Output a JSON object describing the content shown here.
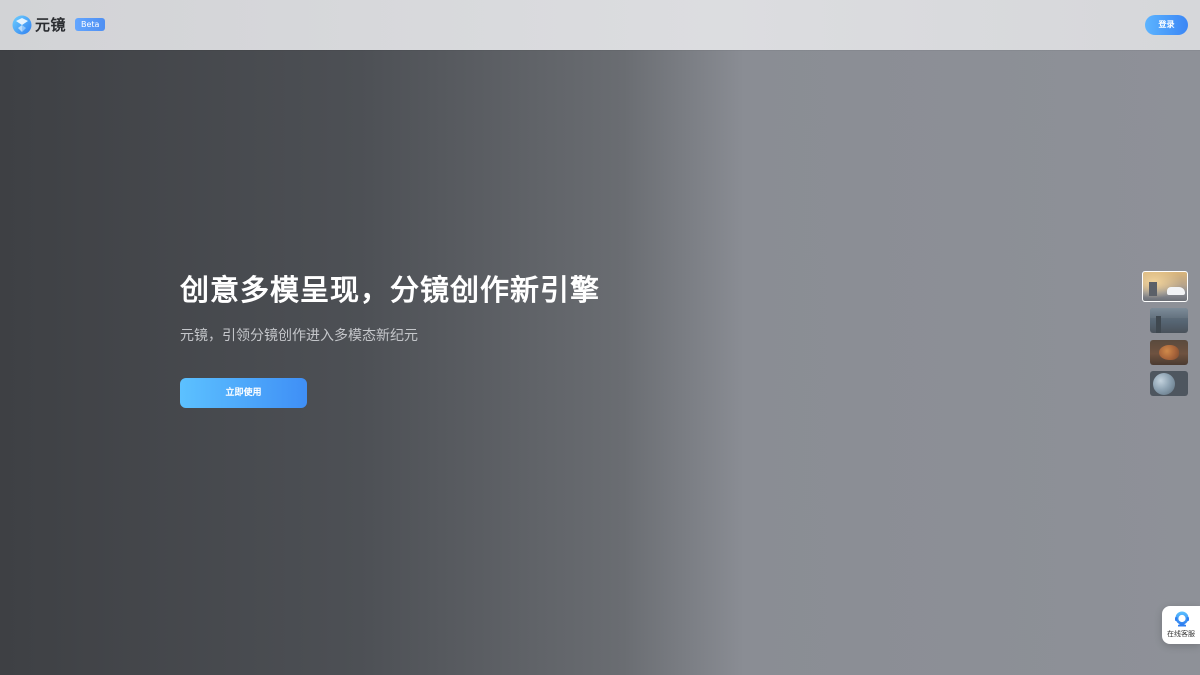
{
  "header": {
    "brand": "元镜",
    "badge": "Beta",
    "login_label": "登录"
  },
  "hero": {
    "title": "创意多模呈现，分镜创作新引擎",
    "subtitle": "元镜，引领分镜创作进入多模态新纪元",
    "cta_label": "立即使用"
  },
  "gallery": {
    "items": [
      {
        "icon": "street-car-thumbnail",
        "selected": true
      },
      {
        "icon": "city-thumbnail",
        "selected": false
      },
      {
        "icon": "bird-thumbnail",
        "selected": false
      },
      {
        "icon": "planet-thumbnail",
        "selected": false
      }
    ]
  },
  "service": {
    "label": "在线客服",
    "icon": "customer-service-icon"
  },
  "colors": {
    "accent": "#3f8ff6",
    "accent_light": "#5cc1ff",
    "hero_title": "#ffffff",
    "hero_subtitle": "#c4c6ca"
  }
}
